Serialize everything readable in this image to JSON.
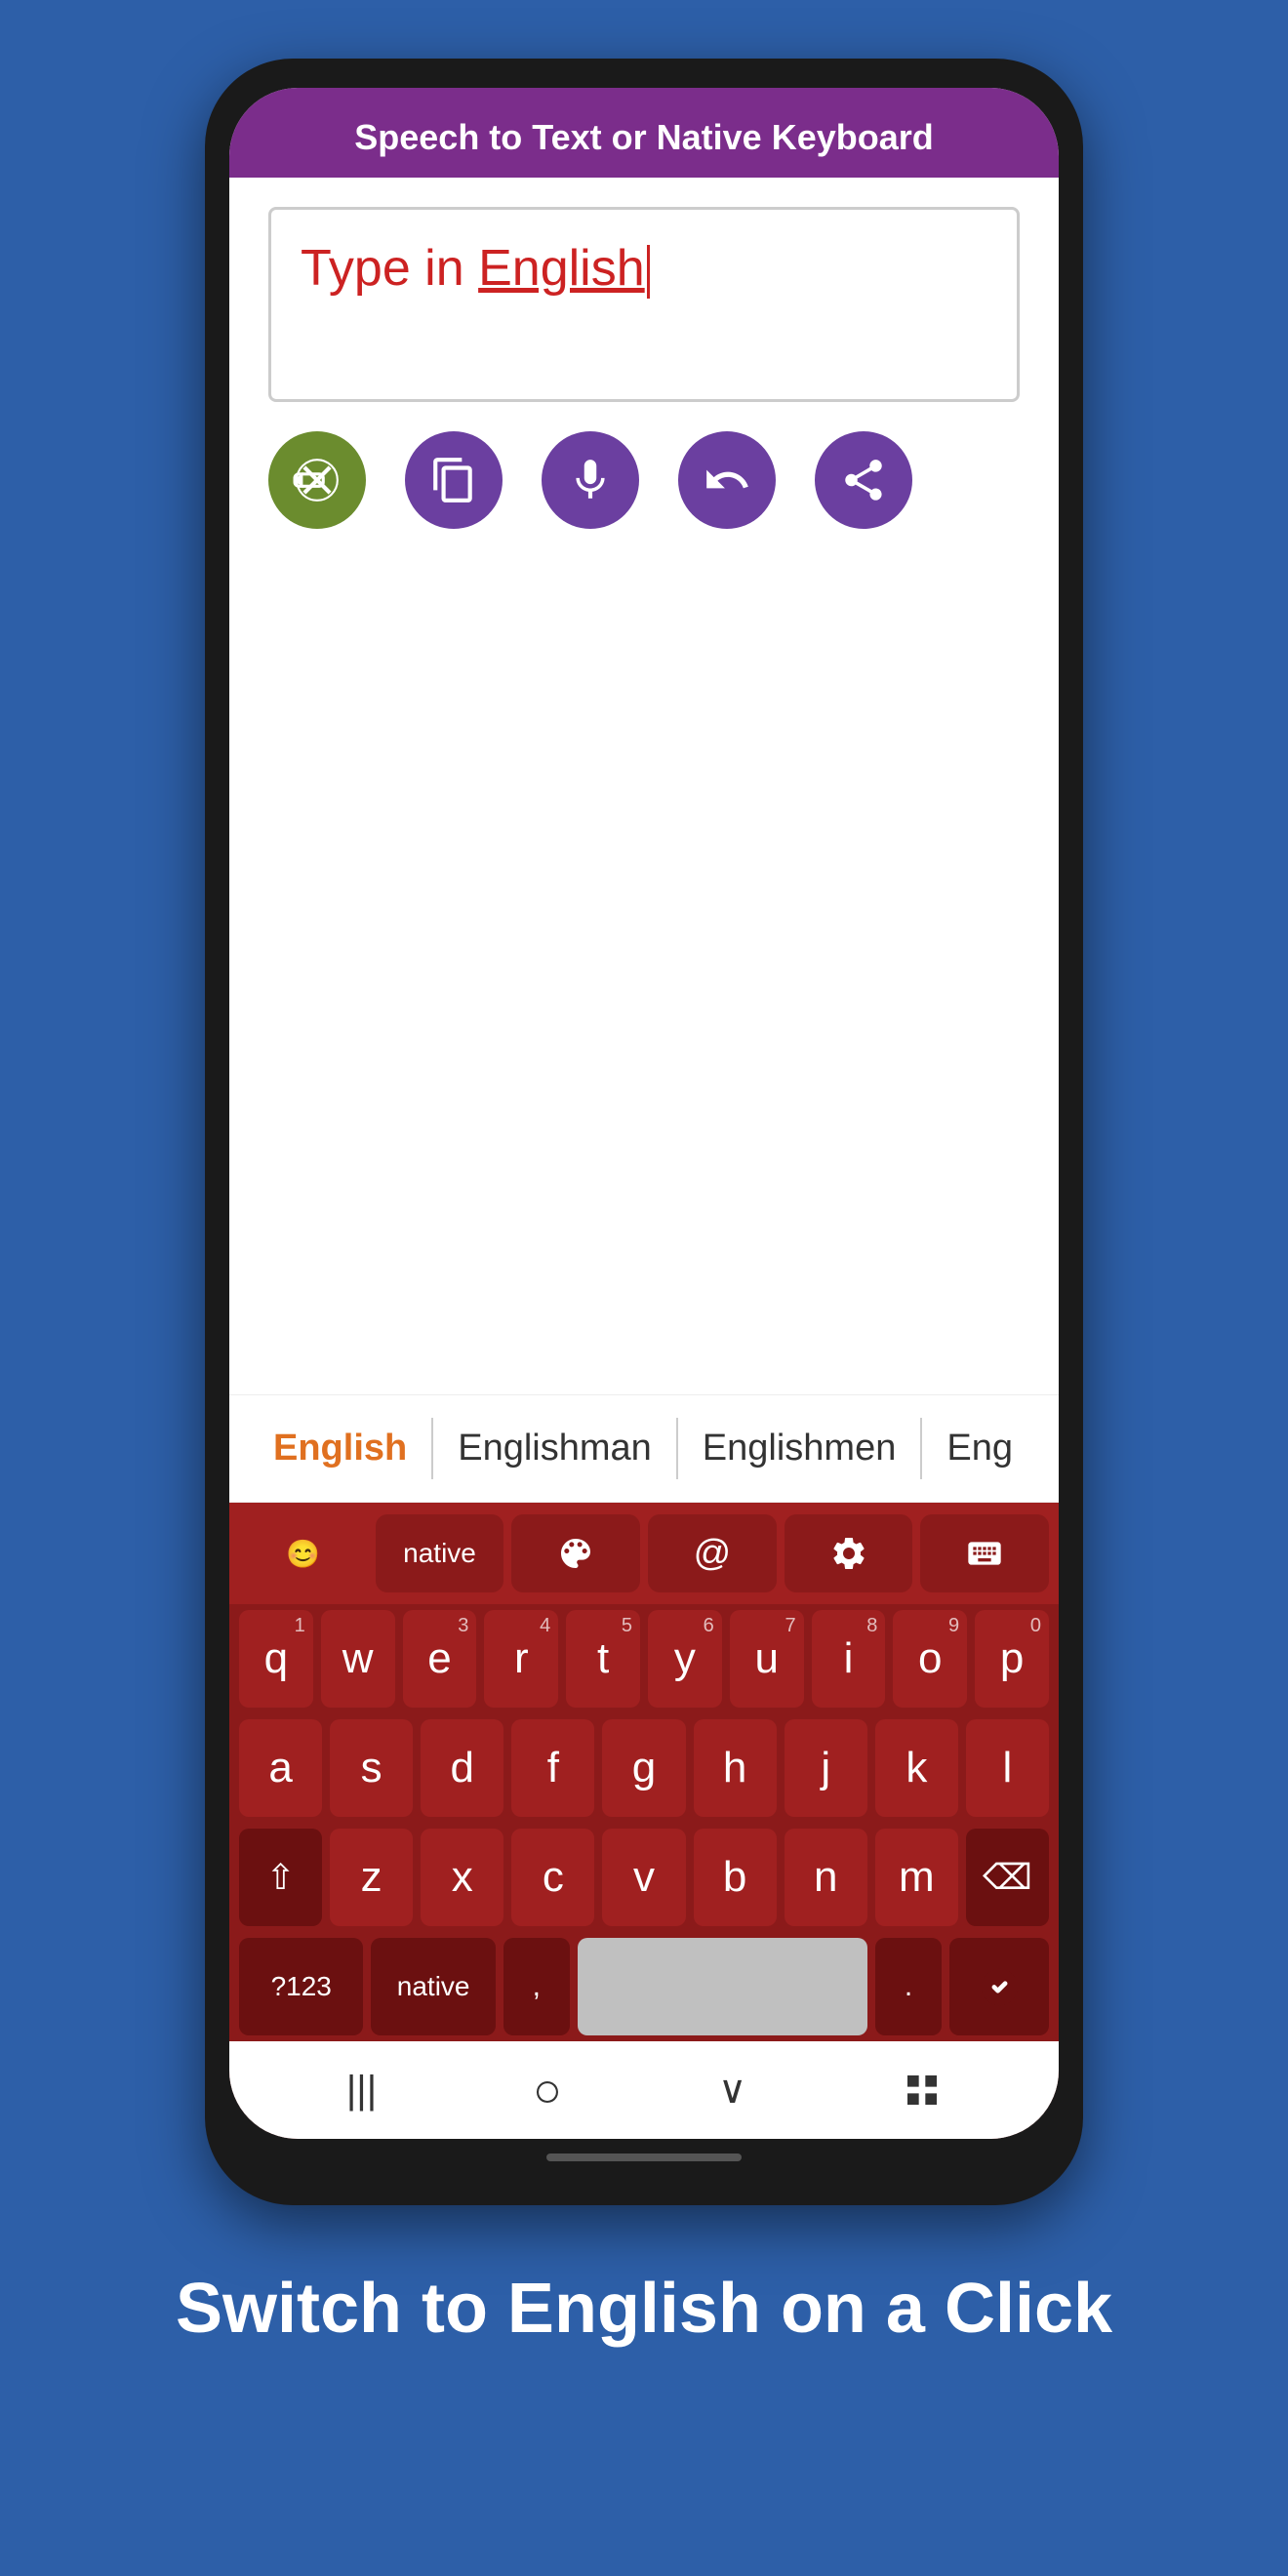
{
  "header": {
    "title": "Speech to Text or Native Keyboard"
  },
  "text_area": {
    "placeholder": "Type in",
    "language": "English",
    "has_cursor": true
  },
  "action_buttons": [
    {
      "id": "delete",
      "label": "delete",
      "color": "#6b8c2e"
    },
    {
      "id": "copy",
      "label": "copy",
      "color": "#6b3fa0"
    },
    {
      "id": "mic",
      "label": "microphone",
      "color": "#6b3fa0"
    },
    {
      "id": "undo",
      "label": "undo",
      "color": "#6b3fa0"
    },
    {
      "id": "share",
      "label": "share",
      "color": "#6b3fa0"
    }
  ],
  "suggestions": [
    {
      "text": "English",
      "active": true
    },
    {
      "text": "Englishman",
      "active": false
    },
    {
      "text": "Englishmen",
      "active": false
    },
    {
      "text": "Eng",
      "active": false
    }
  ],
  "keyboard": {
    "top_row": [
      {
        "id": "emoji",
        "label": "😊"
      },
      {
        "id": "native",
        "label": "native"
      },
      {
        "id": "palette",
        "label": "🎨"
      },
      {
        "id": "at",
        "label": "@"
      },
      {
        "id": "settings",
        "label": "⚙"
      },
      {
        "id": "keyboard_switch",
        "label": "⌨"
      }
    ],
    "rows": [
      [
        "q",
        "w",
        "e",
        "r",
        "t",
        "y",
        "u",
        "i",
        "o",
        "p"
      ],
      [
        "a",
        "s",
        "d",
        "f",
        "g",
        "h",
        "j",
        "k",
        "l"
      ],
      [
        "⇧",
        "z",
        "x",
        "c",
        "v",
        "b",
        "n",
        "m",
        "⌫"
      ],
      [
        "?123",
        "native",
        ",",
        "space",
        ".",
        "✓"
      ]
    ],
    "number_labels": {
      "q": "1",
      "w": "",
      "e": "3",
      "r": "4",
      "t": "5",
      "y": "6",
      "u": "7",
      "i": "8",
      "o": "9",
      "p": "0"
    }
  },
  "nav_bar": {
    "back": "|||",
    "home": "○",
    "down": "⌄",
    "grid": "⊞"
  },
  "bottom_text": "Switch to English on a Click"
}
